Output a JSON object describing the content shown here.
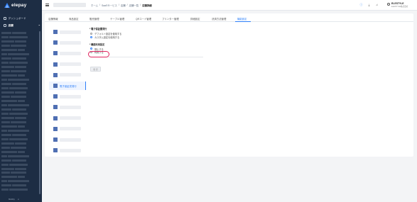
{
  "sidebar": {
    "logo_text": "elepay",
    "items": [
      {
        "label": "ダッシュボード",
        "icon": "dashboard-icon"
      },
      {
        "label": "店舗",
        "icon": "store-icon",
        "expanded": true
      }
    ],
    "footer_left": "Mobility",
    "footer_right": "⊙"
  },
  "header": {
    "breadcrumb": [
      "ホーム",
      "SaaSサービス",
      "店舗",
      "店舗一覧",
      "店舗詳細"
    ],
    "user_name": "ELESTYLE",
    "user_sub": "ELESTYLE株式会社"
  },
  "tabs": [
    {
      "label": "店舗情報",
      "active": false
    },
    {
      "label": "商品設定",
      "active": false
    },
    {
      "label": "販売管理",
      "active": false
    },
    {
      "label": "テーブル管理",
      "active": false
    },
    {
      "label": "QRコード管理",
      "active": false
    },
    {
      "label": "プリンター管理",
      "active": false
    },
    {
      "label": "詳細設定",
      "active": false
    },
    {
      "label": "決済方法管理",
      "active": false
    },
    {
      "label": "機能設定",
      "active": true
    }
  ],
  "store_list": {
    "active_store": "電子保証書発行"
  },
  "settings": {
    "section1_title": "* 電子保証書発行",
    "section1_options": [
      {
        "label": "デフォルト設定を使用する",
        "selected": false
      },
      {
        "label": "カスタム設定を使用する",
        "selected": true
      }
    ],
    "section2_title": "* 機能利用設定",
    "section2_options": [
      {
        "label": "禁止する",
        "selected": true
      },
      {
        "label": "利用する",
        "selected": false
      }
    ],
    "save_label": "保 存"
  },
  "colors": {
    "sidebar_bg": "#1d2d44",
    "accent": "#2d7ff9",
    "highlight": "#e0245e"
  }
}
